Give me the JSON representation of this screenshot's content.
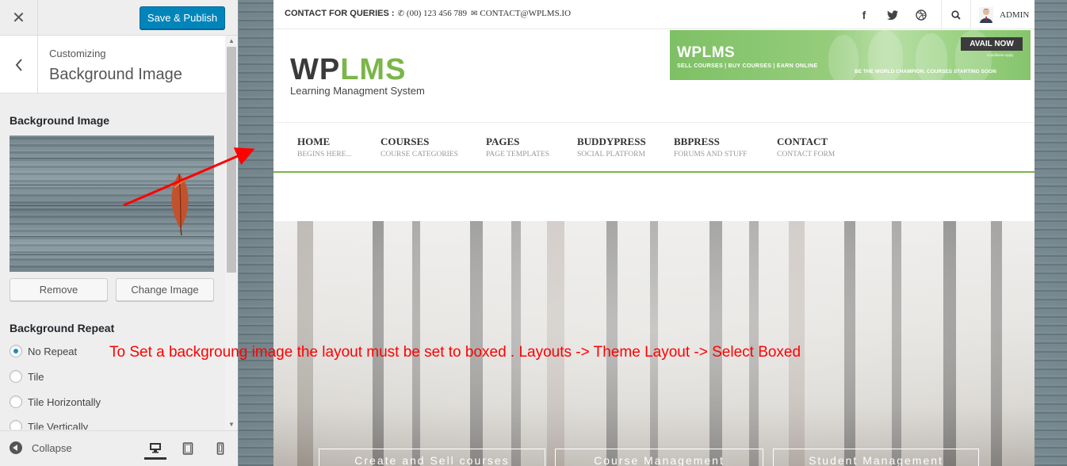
{
  "sidebar": {
    "publish_label": "Save & Publish",
    "customizing_label": "Customizing",
    "section_title": "Background Image",
    "bg_image_title": "Background Image",
    "remove_label": "Remove",
    "change_label": "Change Image",
    "bg_repeat_title": "Background Repeat",
    "repeat_options": [
      "No Repeat",
      "Tile",
      "Tile Horizontally",
      "Tile Vertically"
    ],
    "selected_repeat": "No Repeat",
    "collapse_label": "Collapse",
    "active_device": "desktop"
  },
  "site": {
    "contact_label": "CONTACT FOR QUERIES :",
    "phone": "(00) 123 456 789",
    "email": "CONTACT@WPLMS.IO",
    "admin_label": "ADMIN",
    "logo_part1": "WP",
    "logo_part2": "LMS",
    "tagline": "Learning Managment System",
    "banner": {
      "title": "WPLMS",
      "subtitle": "SELL COURSES | BUY COURSES | EARN ONLINE",
      "button": "AVAIL NOW",
      "conditions": "Conditions Apply",
      "footer": "BE THE WORLD CHAMPION. COURSES STARTING SOON"
    },
    "nav": [
      {
        "label": "HOME",
        "sub": "BEGINS HERE..."
      },
      {
        "label": "COURSES",
        "sub": "COURSE CATEGORIES"
      },
      {
        "label": "PAGES",
        "sub": "PAGE TEMPLATES"
      },
      {
        "label": "BUDDYPRESS",
        "sub": "SOCIAL PLATFORM"
      },
      {
        "label": "BBPRESS",
        "sub": "FORUMS AND STUFF"
      },
      {
        "label": "CONTACT",
        "sub": "CONTACT FORM"
      }
    ],
    "hero_boxes": [
      "Create and Sell courses",
      "Course Management",
      "Student Management"
    ]
  },
  "annotation": "To Set a backgroung image the layout must be set to boxed . Layouts -> Theme Layout -> Select Boxed",
  "colors": {
    "publish_blue": "#0085ba",
    "brand_green": "#7ab648",
    "annotation_red": "#ff0000"
  }
}
